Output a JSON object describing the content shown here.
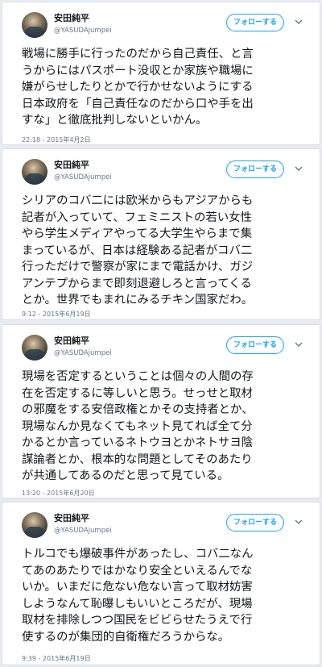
{
  "follow_label": "フォローする",
  "tweets": [
    {
      "name": "安田純平",
      "handle": "@YASUDAjumpei",
      "lines": [
        "戦場に勝手に行ったのだから自己責任、と言",
        "うからにはパスポート没収とか家族や職場に",
        "嫌がらせしたりとかで行かせないようにする",
        "日本政府を「自己責任なのだから口や手を出",
        "すな」と徹底批判しないといかん。"
      ],
      "timestamp": "22:18 - 2015年4月2日"
    },
    {
      "name": "安田純平",
      "handle": "@YASUDAjumpei",
      "lines": [
        "シリアのコバ二には欧米からもアジアからも",
        "記者が入っていて、フェミニストの若い女性",
        "やら学生メディアやってる大学生やらまで集",
        "まっているが、日本は経験ある記者がコバ二",
        "行っただけで警察が家にまで電話かけ、ガジ",
        "アンテプからまで即刻退避しろと言ってくる",
        "とか。世界でもまれにみるチキン国家だわ。"
      ],
      "timestamp": "9:12 - 2015年6月19日"
    },
    {
      "name": "安田純平",
      "handle": "@YASUDAjumpei",
      "lines": [
        "現場を否定するということは個々の人間の存",
        "在を否定するに等しいと思う。せっせと取材",
        "の邪魔をする安倍政権とかその支持者とか、",
        "現場なんか見なくてもネット見てれば全て分",
        "かるとか言っているネトウヨとかネトサヨ陰",
        "謀論者とか、根本的な問題としてそのあたり",
        "が共通してあるのだと思って見ている。"
      ],
      "timestamp": "13:20 - 2015年6月20日"
    },
    {
      "name": "安田純平",
      "handle": "@YASUDAjumpei",
      "lines": [
        "トルコでも爆破事件があったし、コバ二なん",
        "てあのあたりではかなり安全といえるんでな",
        "いか。いまだに危ない危ない言って取材妨害",
        "しようなんて恥曝しもいいところだが、現場",
        "取材を排除しつつ国民をビビらせたうえで行",
        "使するのが集団的自衛権だろうからな。"
      ],
      "timestamp": "9:39 - 2015年6月19日"
    }
  ]
}
